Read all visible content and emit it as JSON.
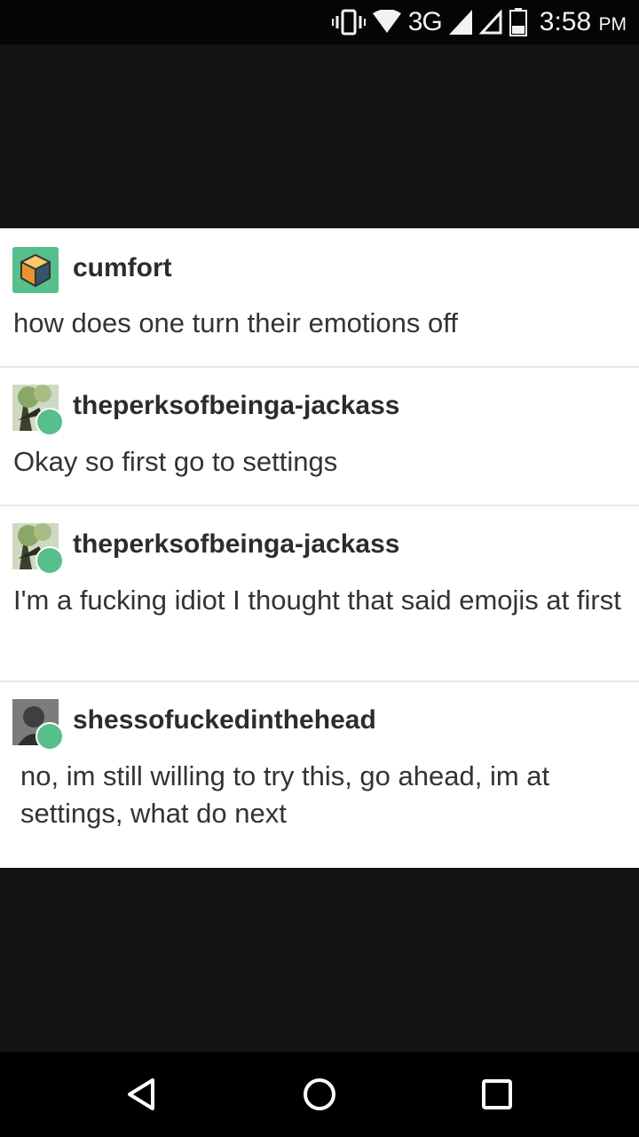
{
  "status_bar": {
    "network": "3G",
    "time": "3:58",
    "ampm": "PM"
  },
  "posts": [
    {
      "username": "cumfort",
      "text": "how does one turn their emotions off",
      "avatar_icon": "cube-icon"
    },
    {
      "username": "theperksofbeinga-jackass",
      "text": "Okay so first go to settings",
      "avatar_icon": "tree-avatar"
    },
    {
      "username": "theperksofbeinga-jackass",
      "text": "I'm a fucking idiot I thought that said emojis at first",
      "avatar_icon": "tree-avatar"
    },
    {
      "username": "shessofuckedinthehead",
      "text": "no, im still willing to try this, go ahead, im at settings, what do next",
      "avatar_icon": "photo-avatar"
    }
  ],
  "nav": {
    "back": "back-icon",
    "home": "home-icon",
    "recents": "recents-icon"
  }
}
